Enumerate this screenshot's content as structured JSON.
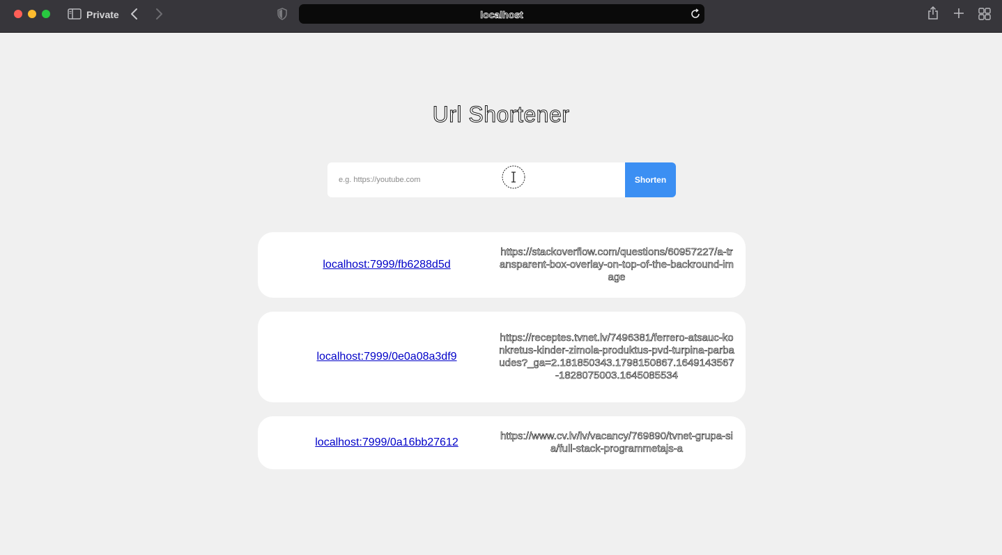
{
  "browser": {
    "mode_label": "Private",
    "address": "localhost",
    "icons": [
      "sidebar-icon",
      "back-icon",
      "forward-icon",
      "shield-icon",
      "reload-icon",
      "share-icon",
      "plus-icon",
      "tabs-overview-icon"
    ]
  },
  "page": {
    "title": "Url Shortener"
  },
  "form": {
    "placeholder": "e.g. https://youtube.com",
    "submit_label": "Shorten",
    "accent_color": "#3b8ff3"
  },
  "links": [
    {
      "short": "localhost:7999/fb6288d5d",
      "original": "https://stackoverflow.com/questions/60957227/a-transparent-box-overlay-on-top-of-the-backround-image"
    },
    {
      "short": "localhost:7999/0e0a08a3df9",
      "original": "https://receptes.tvnet.lv/7496381/ferrero-atsauc-konkretus-kinder-zimola-produktus-pvd-turpina-parbaudes?_ga=2.181850343.1798150867.1649143567-1828075003.1645085534"
    },
    {
      "short": "localhost:7999/0a16bb27612",
      "original": "https://www.cv.lv/lv/vacancy/769890/tvnet-grupa-sia/full-stack-programmetajs-a"
    }
  ]
}
